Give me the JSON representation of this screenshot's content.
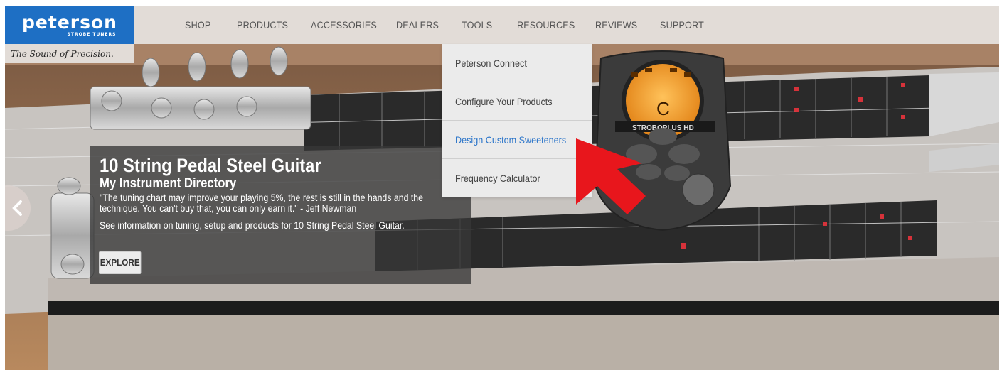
{
  "header": {
    "logo_text": "peterson",
    "logo_sub": "STROBE TUNERS",
    "tagline": "The Sound of Precision.",
    "nav": [
      "SHOP",
      "PRODUCTS",
      "ACCESSORIES",
      "DEALERS",
      "TOOLS",
      "RESOURCES",
      "REVIEWS",
      "SUPPORT"
    ]
  },
  "tools_menu": {
    "items": [
      "Peterson Connect",
      "Configure Your Products",
      "Design Custom Sweeteners",
      "Frequency Calculator"
    ],
    "active": "Design Custom Sweeteners"
  },
  "slide": {
    "title": "10 String Pedal Steel Guitar",
    "subtitle": "My Instrument Directory",
    "quote": "\"The tuning chart may improve your playing 5%, the rest is still in the hands and the technique. You can't buy that, you can only earn it.\" - Jeff Newman",
    "info": "See information on tuning, setup and products for 10 String Pedal Steel Guitar.",
    "button_label": "EXPLORE"
  },
  "tuner_display": {
    "note": "C",
    "brand": "STROBOPLUS HD"
  },
  "colors": {
    "logo_blue": "#1e6fc4",
    "header_bg": "#e2dcd7",
    "link_active": "#2a74c9",
    "annotation_red": "#e8161c",
    "tuner_orange": "#f7a12a"
  },
  "icons": {
    "prev": "chevron-left-icon",
    "annotation": "red-arrow-icon"
  }
}
